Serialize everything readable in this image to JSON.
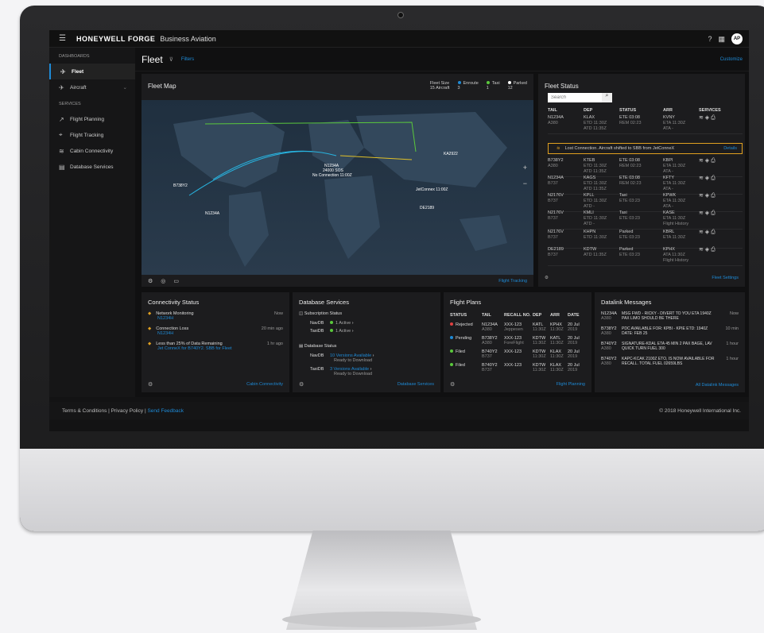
{
  "app": {
    "brand": "HONEYWELL FORGE",
    "product": "Business Aviation",
    "avatar": "AP"
  },
  "sidebar": {
    "dashboards_heading": "DASHBOARDS",
    "services_heading": "SERVICES",
    "dashboards": [
      {
        "label": "Fleet"
      },
      {
        "label": "Aircraft"
      }
    ],
    "services": [
      {
        "label": "Flight Planning"
      },
      {
        "label": "Flight Tracking"
      },
      {
        "label": "Cabin Connectivity"
      },
      {
        "label": "Database Services"
      }
    ]
  },
  "fleet": {
    "title": "Fleet",
    "filters": "Filters",
    "customize": "Customize"
  },
  "fleet_map": {
    "title": "Fleet Map",
    "fleet_size_label": "Fleet Size",
    "fleet_size_value": "15 Aircraft",
    "enroute_label": "Enroute",
    "enroute_value": "3",
    "taxi_label": "Taxi",
    "taxi_value": "1",
    "parked_label": "Parked",
    "parked_value": "12",
    "labels": [
      "N1234A",
      "24000 SOS",
      "No Connection 11:00Z",
      "B738Y2",
      "JetConnex 11:00Z",
      "N1234A",
      "KA2922",
      "DE2189"
    ],
    "footer_link": "Flight Tracking"
  },
  "fleet_status": {
    "title": "Fleet Status",
    "search_placeholder": "Search",
    "columns": [
      "TAIL",
      "DEP",
      "STATUS",
      "ARR",
      "SERVICES"
    ],
    "rows": [
      {
        "tail": "N1234A",
        "type": "A380",
        "dep": "KLAX",
        "dep_etd": "ETD 11:30Z",
        "dep_atd": "ATD 11:35Z",
        "status1": "ETE 03:08",
        "status2": "REM 02:23",
        "arr": "KVNY",
        "arr_eta": "ETA 11:30Z",
        "arr_ata": "ATA -"
      },
      {
        "tail": "B738Y2",
        "type": "A380",
        "dep": "KTEB",
        "dep_etd": "ETD 11:30Z",
        "dep_atd": "ATD 11:35Z",
        "status1": "ETE 03:08",
        "status2": "REM 02:23",
        "arr": "KBPI",
        "arr_eta": "ETA 11:30Z",
        "arr_ata": "ATA -"
      },
      {
        "tail": "N1234A",
        "type": "B737",
        "dep": "KAGS",
        "dep_etd": "ETD 11:30Z",
        "dep_atd": "ATD 11:35Z",
        "status1": "ETE 03:08",
        "status2": "REM 02:23",
        "arr": "KFTY",
        "arr_eta": "ETA 11:30Z",
        "arr_ata": "ATA -"
      },
      {
        "tail": "N2176V",
        "type": "B737",
        "dep": "KPLL",
        "dep_etd": "ETD 11:30Z",
        "dep_atd": "ATD -",
        "status1": "Taxi",
        "status2": "ETE 03:23",
        "arr": "KPWK",
        "arr_eta": "ETA 11:30Z",
        "arr_ata": "ATA -"
      },
      {
        "tail": "N2176V",
        "type": "B737",
        "dep": "KMLI",
        "dep_etd": "ETD 11:30Z",
        "dep_atd": "ATD -",
        "status1": "Taxi",
        "status2": "ETE 03:23",
        "arr": "KASE",
        "arr_eta": "ETA 11:30Z",
        "arr_ata": "Flight History"
      },
      {
        "tail": "N2176V",
        "type": "B737",
        "dep": "KHPN",
        "dep_etd": "ETD 11:30Z",
        "dep_atd": "",
        "status1": "Parked",
        "status2": "ETE 03:23",
        "arr": "KBRL",
        "arr_eta": "ETA 11:30Z",
        "arr_ata": ""
      },
      {
        "tail": "DE2189",
        "type": "B737",
        "dep": "KDTW",
        "dep_etd": "ATD 11:35Z",
        "dep_atd": "",
        "status1": "Parked",
        "status2": "ETE 03:23",
        "arr": "KPHX",
        "arr_eta": "ATA 11:30Z",
        "arr_ata": "Flight History"
      }
    ],
    "alert_text": "Lost Connection. Aircraft shifted to SBB from JetConneX",
    "alert_link": "Details",
    "footer_link": "Fleet Settings"
  },
  "connectivity": {
    "title": "Connectivity Status",
    "items": [
      {
        "title": "Network Monitoring",
        "sub": "N1234H",
        "time": "Now"
      },
      {
        "title": "Connection Loss",
        "sub": "N1234H",
        "time": "20 min ago"
      },
      {
        "title": "Less than 25% of Data Remaining",
        "sub": "Jet ConneX for B740Y2. SBB for Fleet",
        "time": "1 hr ago"
      }
    ],
    "footer_link": "Cabin Connectivity"
  },
  "database": {
    "title": "Database Services",
    "subscription_heading": "Subscription Status",
    "subs": [
      {
        "name": "NavDB",
        "value": "1 Active"
      },
      {
        "name": "TaxiDB",
        "value": "1 Active"
      }
    ],
    "status_heading": "Database Status",
    "status": [
      {
        "name": "NavDB",
        "link": "10 Versions Available",
        "sub": "Ready to Download"
      },
      {
        "name": "TaxiDB",
        "link": "3 Versions Available",
        "sub": "Ready to Download"
      }
    ],
    "footer_link": "Database Services"
  },
  "flight_plans": {
    "title": "Flight Plans",
    "columns": [
      "STATUS",
      "TAIL",
      "RECALL NO.",
      "DEP",
      "ARR",
      "DATE"
    ],
    "rows": [
      {
        "status": "Rejected",
        "tail": "N1234A",
        "type": "A380",
        "recall": "XXX-123",
        "tag": "Jeppesen",
        "dep": "KATL",
        "dep_t": "11:30Z",
        "arr": "KPHX",
        "arr_t": "11:30Z",
        "date": "20 Jul",
        "year": "2019"
      },
      {
        "status": "Pending",
        "tail": "B738Y2",
        "type": "A380",
        "recall": "XXX-123",
        "tag": "ForeFlight",
        "dep": "KDTW",
        "dep_t": "11:30Z",
        "arr": "KATL",
        "arr_t": "11:30Z",
        "date": "20 Jul",
        "year": "2019"
      },
      {
        "status": "Filed",
        "tail": "B740Y2",
        "type": "B737",
        "recall": "XXX-123",
        "tag": "",
        "dep": "KDTW",
        "dep_t": "11:30Z",
        "arr": "KLAX",
        "arr_t": "11:30Z",
        "date": "20 Jul",
        "year": "2019"
      },
      {
        "status": "Filed",
        "tail": "B740Y2",
        "type": "B737",
        "recall": "XXX-123",
        "tag": "",
        "dep": "KDTW",
        "dep_t": "11:30Z",
        "arr": "KLAX",
        "arr_t": "11:30Z",
        "date": "20 Jul",
        "year": "2019"
      }
    ],
    "footer_link": "Flight Planning"
  },
  "datalink": {
    "title": "Datalink Messages",
    "items": [
      {
        "tail": "N1234A",
        "type": "A380",
        "msg": "MSG FWD - RICKY - DIVERT TO YOU ETA 1940Z PAX LIMO SHOULD BE THERE",
        "time": "Now"
      },
      {
        "tail": "B738Y2",
        "type": "A380",
        "msg": "PDC AVAILABLE FOR: KPBI - KPIE ETD: 1940Z DATE: FEB 25",
        "time": "10 min"
      },
      {
        "tail": "B740Y2",
        "type": "A380",
        "msg": "SIGNATURE-KDAL ETA 45 MIN 2 PAX BAGE, LAV QUICK TURN FUEL 300",
        "time": "1 hour"
      },
      {
        "tail": "B740Y2",
        "type": "A380",
        "msg": "KAPC-KCAK 2100Z ETO, IS NOW AVAILABLE FOR RECALL. TOTAL FUEL 02659LBS",
        "time": "1 hour"
      }
    ],
    "footer_link": "All Datalink Messages"
  },
  "footer": {
    "terms": "Terms & Conditions",
    "privacy": "Privacy Policy",
    "feedback": "Send Feedback",
    "copyright": "© 2018 Honeywell International Inc."
  }
}
